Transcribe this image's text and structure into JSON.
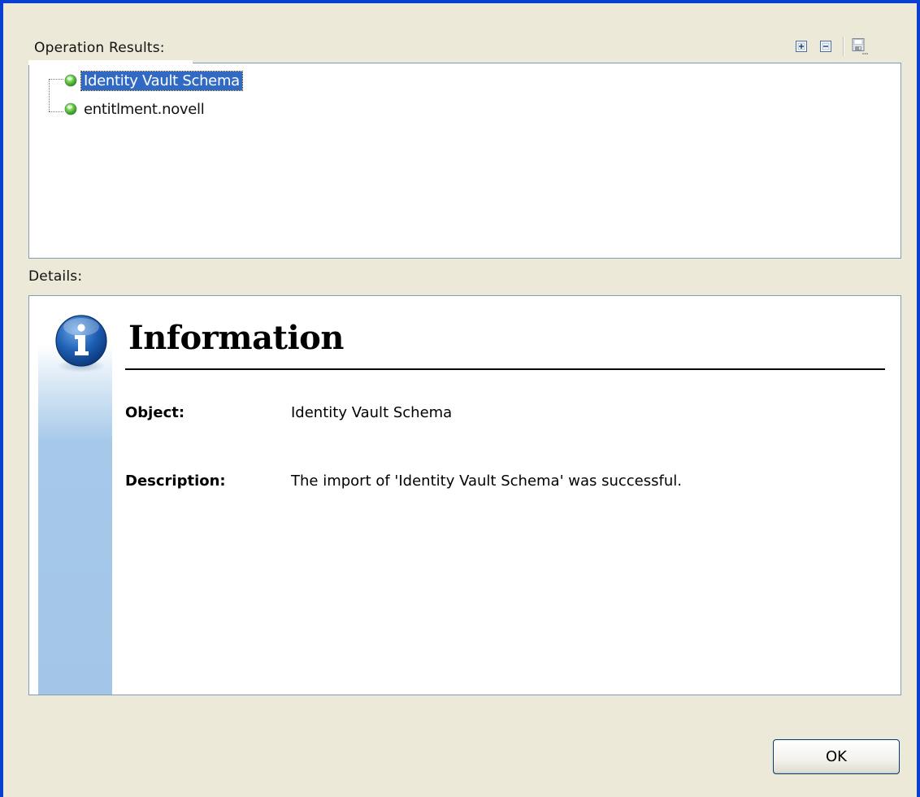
{
  "operation_results": {
    "label": "Operation Results:",
    "toolbar": {
      "expand_icon": "expand-all-icon",
      "collapse_icon": "collapse-all-icon",
      "save_icon": "save-icon"
    },
    "tree": [
      {
        "label": "Identity Vault Schema",
        "status": "success",
        "selected": true
      },
      {
        "label": "entitlment.novell",
        "status": "success",
        "selected": false
      }
    ]
  },
  "details": {
    "label": "Details:",
    "icon": "info-icon",
    "title": "Information",
    "object_label": "Object:",
    "object_value": "Identity Vault Schema",
    "description_label": "Description:",
    "description_value": "The import of 'Identity Vault Schema' was successful."
  },
  "buttons": {
    "ok_label": "OK"
  },
  "colors": {
    "selection": "#316ac5",
    "window_border": "#0a3fd1",
    "dialog_bg": "#ece9d8",
    "side_bar": "#a3c6e8"
  }
}
